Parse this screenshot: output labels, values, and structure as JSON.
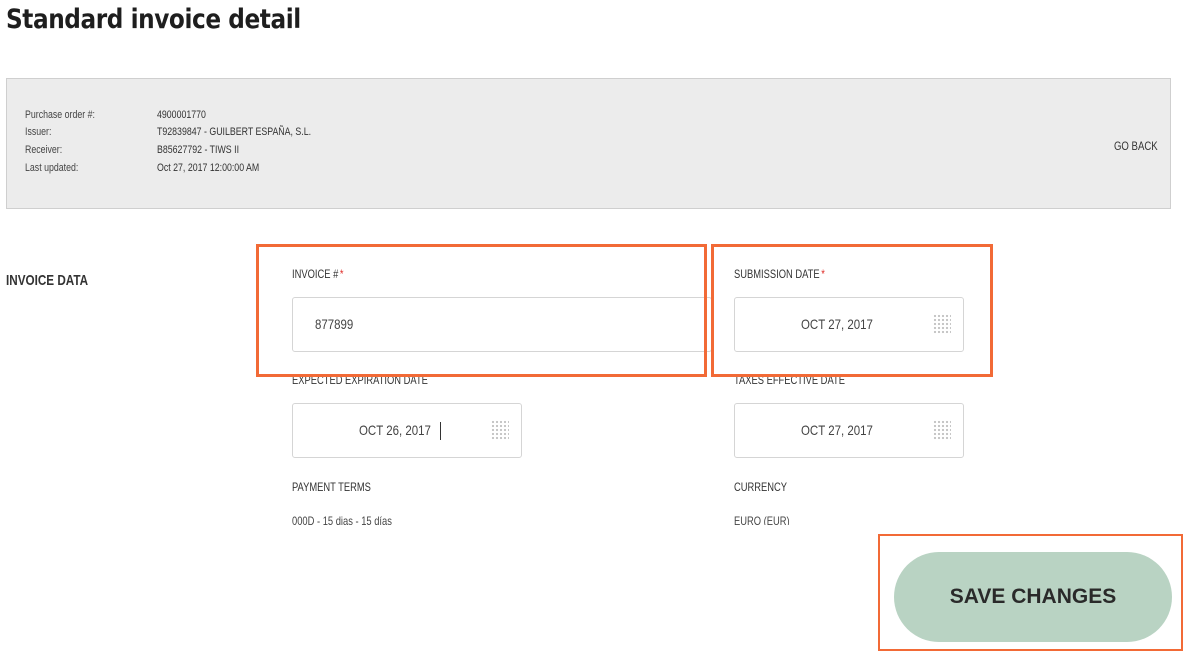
{
  "page": {
    "title": "Standard invoice detail"
  },
  "summary": {
    "rows": [
      {
        "label": "Purchase order #:",
        "value": "4900001770"
      },
      {
        "label": "Issuer:",
        "value": "T92839847 - GUILBERT ESPAÑA, S.L."
      },
      {
        "label": "Receiver:",
        "value": "B85627792 - TIWS II"
      },
      {
        "label": "Last updated:",
        "value": "Oct 27, 2017 12:00:00 AM"
      }
    ],
    "go_back": "GO BACK"
  },
  "invoice_data": {
    "section_title": "INVOICE DATA",
    "invoice_number": {
      "label": "INVOICE #",
      "required_mark": "*",
      "value": "877899"
    },
    "submission_date": {
      "label": "SUBMISSION DATE",
      "required_mark": "*",
      "value": "OCT 27, 2017",
      "icon": "calendar-icon"
    },
    "expected_expiration_date": {
      "label": "EXPECTED EXPIRATION DATE",
      "value": "OCT 26, 2017",
      "icon": "calendar-icon"
    },
    "taxes_effective_date": {
      "label": "TAXES EFFECTIVE DATE",
      "value": "OCT 27, 2017",
      "icon": "calendar-icon"
    },
    "payment_terms": {
      "label": "PAYMENT TERMS",
      "value": "000D - 15 dias - 15 días"
    },
    "currency": {
      "label": "CURRENCY",
      "value": "EURO (EUR)"
    }
  },
  "actions": {
    "save_label": "SAVE CHANGES"
  },
  "colors": {
    "highlight": "#f26a36",
    "save_button_bg": "#b9d3c3",
    "panel_bg": "#ececec",
    "required": "#e0302b"
  }
}
